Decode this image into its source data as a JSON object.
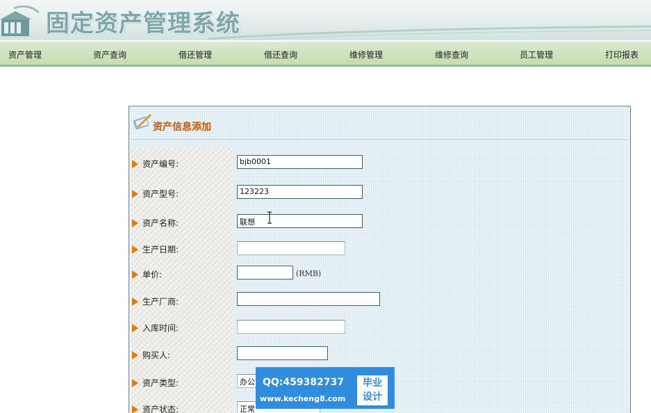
{
  "app": {
    "title": "固定资产管理系统"
  },
  "nav": {
    "items": [
      "资产管理",
      "资产查询",
      "借还管理",
      "借还查询",
      "维修管理",
      "维修查询",
      "员工管理",
      "打印报表"
    ]
  },
  "form": {
    "heading": "资产信息添加",
    "fields": [
      {
        "label": "资产编号:",
        "value": "bjb0001"
      },
      {
        "label": "资产型号:",
        "value": "123223"
      },
      {
        "label": "资产名称:",
        "value": "联想"
      },
      {
        "label": "生产日期:",
        "value": ""
      },
      {
        "label": "单价:",
        "value": "",
        "unit": "(RMB)"
      },
      {
        "label": "生产厂商:",
        "value": ""
      },
      {
        "label": "入库时间:",
        "value": ""
      },
      {
        "label": "购买人:",
        "value": ""
      },
      {
        "label": "资产类型:",
        "value": "办公"
      },
      {
        "label": "资产状态:",
        "value": "正常"
      }
    ]
  },
  "watermark": {
    "qq": "QQ:459382737",
    "site": "www.kecheng8.com",
    "badge_line1": "毕业",
    "badge_line2": "设计"
  },
  "colors": {
    "accent_orange": "#e07a10",
    "heading": "#c8560a",
    "nav_bg": "#c5dcb0",
    "watermark_blue": "#2f8ddf"
  }
}
